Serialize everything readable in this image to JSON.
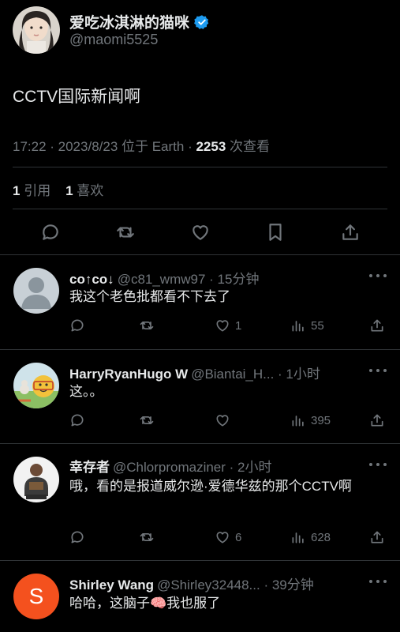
{
  "main_tweet": {
    "display_name": "爱吃冰淇淋的猫咪",
    "handle": "@maomi5525",
    "text": "CCTV国际新闻啊",
    "time": "17:22 · 2023/8/23 位于 Earth · ",
    "views_count": "2253",
    "views_label": " 次查看",
    "quotes_count": "1",
    "quotes_label": " 引用",
    "likes_count": "1",
    "likes_label": " 喜欢"
  },
  "replies": [
    {
      "name": "co↑co↓",
      "meta": "@c81_wmw97 · 15分钟",
      "text": "我这个老色批都看不下去了",
      "likes": "1",
      "views": "55"
    },
    {
      "name": "HarryRyanHugo W",
      "meta": "@Biantai_H... · 1小时",
      "text": "这。。",
      "likes": "",
      "views": "395"
    },
    {
      "name": "幸存者",
      "meta": "@Chlorpromaziner · 2小时",
      "text": "哦，看的是报道威尔逊·爱德华兹的那个CCTV啊",
      "likes": "6",
      "views": "628"
    },
    {
      "name": "Shirley Wang",
      "meta": "@Shirley32448... · 39分钟",
      "text": "哈哈，这脑子🧠我也服了",
      "avatar_letter": "S"
    }
  ],
  "colors": {
    "background": "#000000",
    "text": "#e7e9ea",
    "muted": "#71767b",
    "divider": "#2f3336",
    "verified": "#1d9bf0",
    "avatar_orange": "#f4511e"
  }
}
